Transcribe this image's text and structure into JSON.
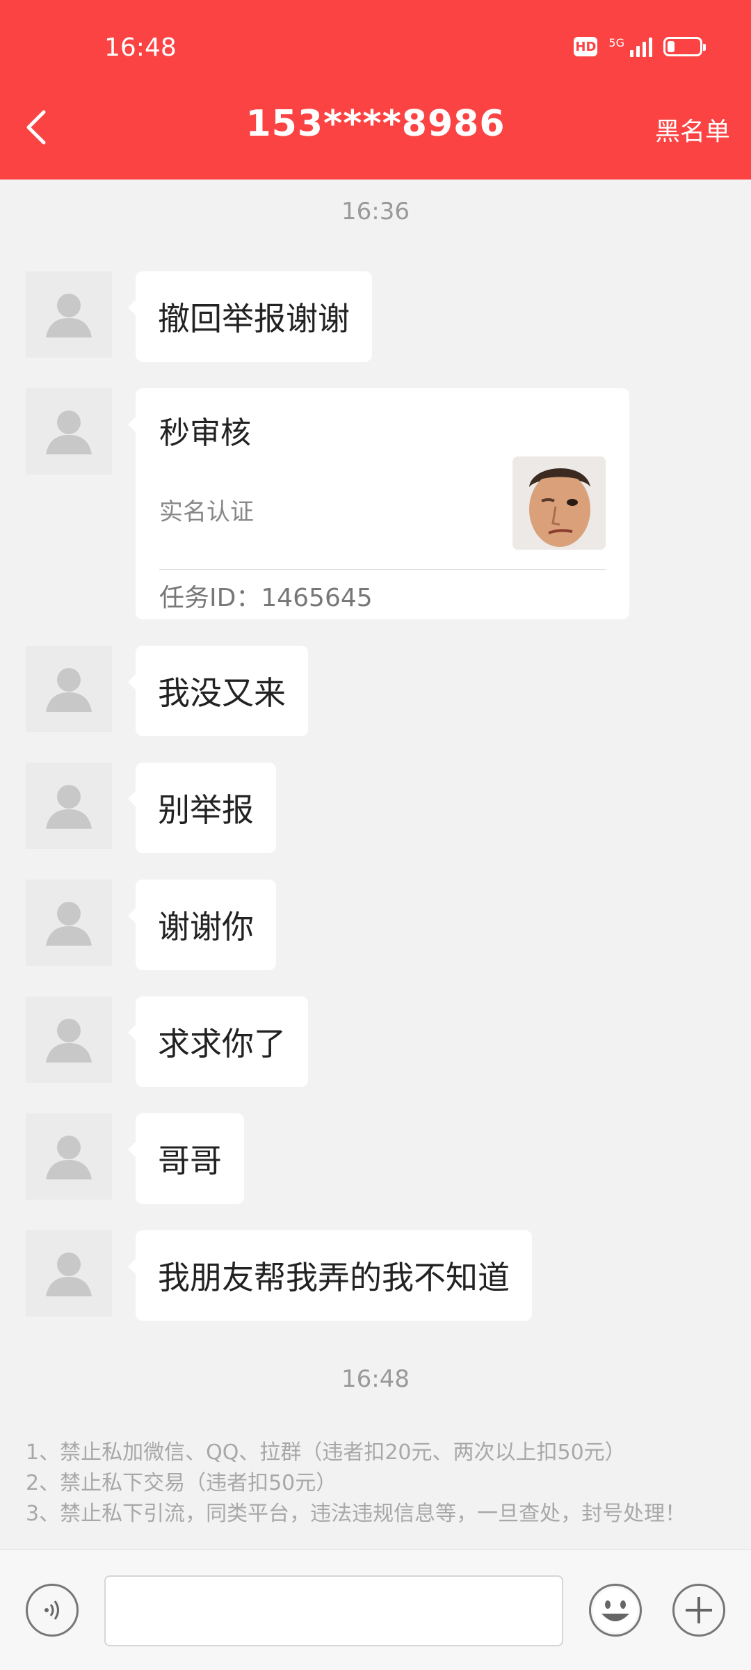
{
  "status_bar": {
    "time": "16:48",
    "hd": "HD",
    "network": "5G"
  },
  "header": {
    "title": "153****8986",
    "right_action": "黑名单"
  },
  "timestamps": [
    "16:36",
    "16:48"
  ],
  "messages": [
    {
      "text": "撤回举报谢谢"
    },
    {
      "type": "task_card",
      "title": "秒审核",
      "subtitle": "实名认证",
      "task_id": "任务ID：1465645"
    },
    {
      "text": "我没又来"
    },
    {
      "text": "别举报"
    },
    {
      "text": "谢谢你"
    },
    {
      "text": "求求你了"
    },
    {
      "text": "哥哥"
    },
    {
      "text": "我朋友帮我弄的我不知道"
    }
  ],
  "rules": [
    "1、禁止私加微信、QQ、拉群（违者扣20元、两次以上扣50元）",
    "2、禁止私下交易（违者扣50元）",
    "3、禁止私下引流，同类平台，违法违规信息等，一旦查处，封号处理！"
  ],
  "input": {
    "value": "",
    "placeholder": ""
  },
  "colors": {
    "brand": "#fb4343",
    "background": "#f2f2f2",
    "bubble": "#ffffff"
  }
}
